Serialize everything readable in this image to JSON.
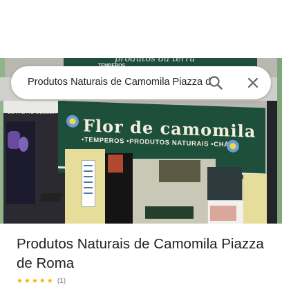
{
  "search": {
    "query": "Produtos Naturais de Camomila Piazza de Roma"
  },
  "icons": {
    "search": "search-icon",
    "close": "close-icon"
  },
  "photo": {
    "upper_sign_text": "produtos da terra",
    "upper_sign_subtext": "TEMPEROS",
    "awning_title": "Flor de camomila",
    "awning_subtitle": "•TEMPEROS •PRODUTOS NATURAIS •CHÁ'S",
    "left_shop_sign": "ESTHETIC BELEZA"
  },
  "place": {
    "title": "Produtos Naturais de Camomila Piazza de Roma",
    "rating_stars": "★★★★★",
    "rating_count": "(1)"
  },
  "colors": {
    "awning_green": "#1e4f3a",
    "text_primary": "#202124",
    "icon_gray": "#5f6368",
    "star_yellow": "#f4b400"
  }
}
